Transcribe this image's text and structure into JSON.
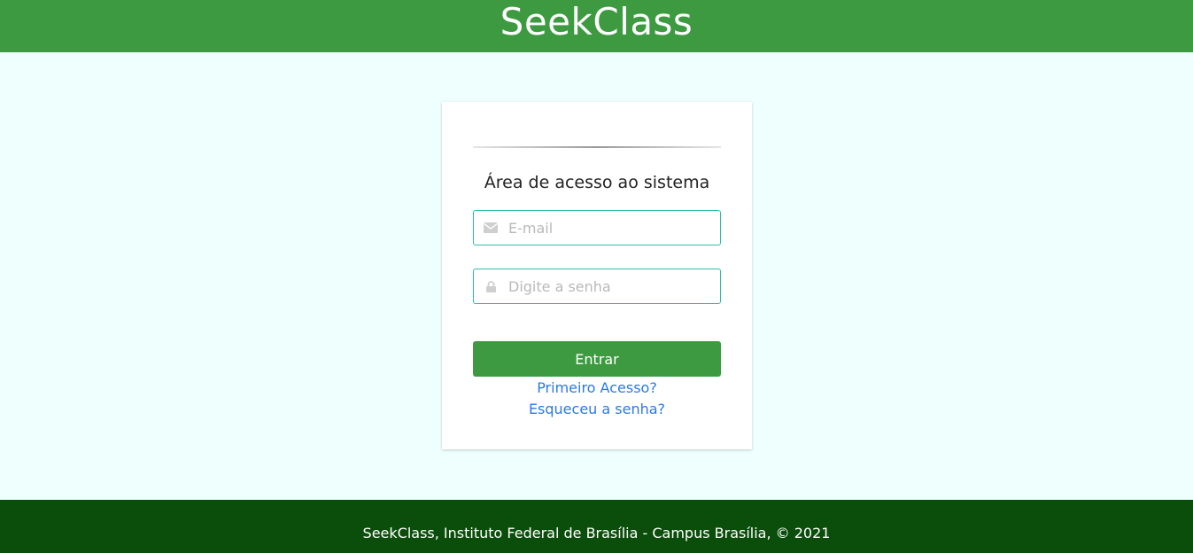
{
  "header": {
    "title": "SeekClass"
  },
  "login": {
    "title": "Área de acesso ao sistema",
    "email": {
      "icon": "envelope-icon",
      "placeholder": "E-mail",
      "value": ""
    },
    "password": {
      "icon": "lock-icon",
      "placeholder": "Digite a senha",
      "value": ""
    },
    "submit_label": "Entrar",
    "first_access_label": "Primeiro Acesso?",
    "forgot_password_label": "Esqueceu a senha?"
  },
  "footer": {
    "text": "SeekClass, Instituto Federal de Brasília - Campus Brasília, © 2021"
  },
  "colors": {
    "header_bg": "#3e9a41",
    "page_bg": "#eefffe",
    "footer_bg": "#0b4e0b",
    "input_border": "#2abfab",
    "link": "#2a7ae2"
  }
}
